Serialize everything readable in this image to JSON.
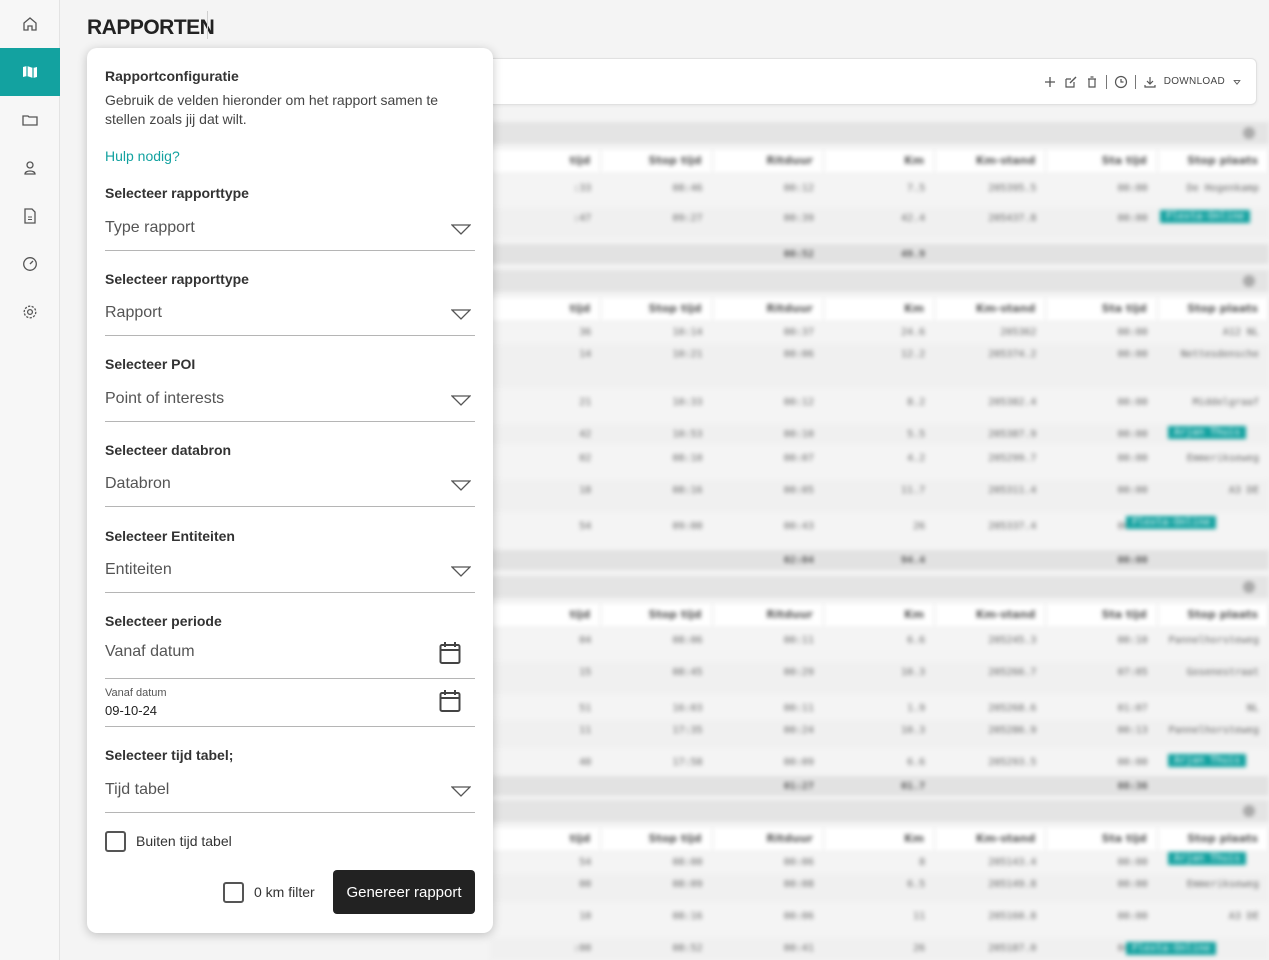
{
  "app": {
    "page_title": "RAPPORTEN"
  },
  "sidebar": {
    "items": [
      {
        "icon": "home-icon",
        "active": false
      },
      {
        "icon": "map-icon",
        "active": true
      },
      {
        "icon": "folder-icon",
        "active": false
      },
      {
        "icon": "user-icon",
        "active": false
      },
      {
        "icon": "document-icon",
        "active": false
      },
      {
        "icon": "dashboard-icon",
        "active": false
      },
      {
        "icon": "settings-icon",
        "active": false
      }
    ]
  },
  "toolbar": {
    "download_label": "DOWNLOAD",
    "icons": [
      "add-icon",
      "edit-icon",
      "delete-icon",
      "history-icon",
      "download-icon",
      "chevron-down-icon"
    ]
  },
  "panel": {
    "title": "Rapportconfiguratie",
    "description": "Gebruik de velden hieronder om het rapport samen te stellen zoals jij dat wilt.",
    "help_link": "Hulp nodig?",
    "fields": {
      "report_type": {
        "label": "Selecteer rapporttype",
        "placeholder": "Type rapport"
      },
      "report": {
        "label": "Selecteer rapporttype",
        "placeholder": "Rapport"
      },
      "poi": {
        "label": "Selecteer POI",
        "placeholder": "Point of interests"
      },
      "datasource": {
        "label": "Selecteer databron",
        "placeholder": "Databron"
      },
      "entities": {
        "label": "Selecteer Entiteiten",
        "placeholder": "Entiteiten"
      },
      "period": {
        "label": "Selecteer periode",
        "from_placeholder": "Vanaf datum",
        "second_label": "Vanaf datum",
        "second_value": "09-10-24"
      },
      "time_table": {
        "label": "Selecteer tijd tabel;",
        "placeholder": "Tijd tabel"
      }
    },
    "checkboxes": {
      "outside_time_table": {
        "label": "Buiten tijd tabel",
        "checked": false
      },
      "zero_km_filter": {
        "label": "0 km filter",
        "checked": false
      }
    },
    "generate_button": "Genereer rapport"
  },
  "colors": {
    "accent": "#13a2a0",
    "button_dark": "#222222"
  }
}
